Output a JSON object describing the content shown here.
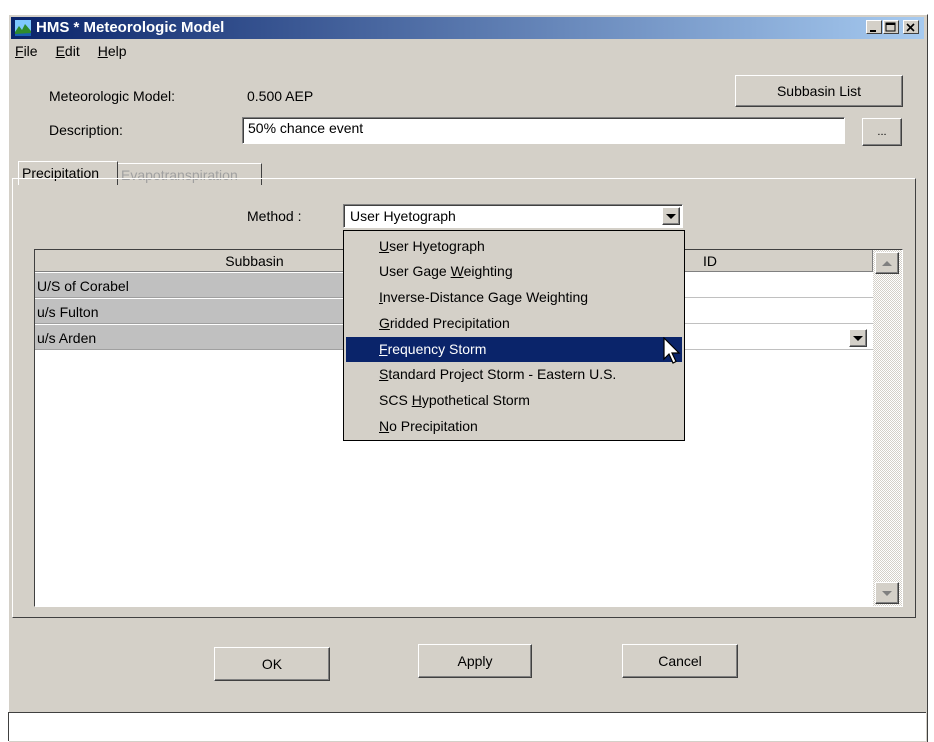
{
  "window": {
    "title": "HMS * Meteorologic Model",
    "controls": [
      "minimize",
      "maximize",
      "close"
    ]
  },
  "menu": [
    {
      "label": "File",
      "mnemonic": "F",
      "rest": "ile"
    },
    {
      "label": "Edit",
      "mnemonic": "E",
      "rest": "dit"
    },
    {
      "label": "Help",
      "mnemonic": "H",
      "rest": "elp"
    }
  ],
  "form": {
    "model_label": "Meteorologic Model:",
    "model_value": "0.500 AEP",
    "description_label": "Description:",
    "description_value": "50% chance event",
    "subbasin_list_button": "Subbasin List",
    "ellipsis_button": "..."
  },
  "tabs": [
    {
      "label": "Precipitation",
      "active": true
    },
    {
      "label": "Evapotranspiration",
      "active": false
    }
  ],
  "method": {
    "label": "Method :",
    "value": "User Hyetograph",
    "options": [
      {
        "pre": "",
        "u": "U",
        "post": "ser Hyetograph",
        "selected": false
      },
      {
        "pre": "User Gage ",
        "u": "W",
        "post": "eighting",
        "selected": false
      },
      {
        "pre": "",
        "u": "I",
        "post": "nverse-Distance Gage Weighting",
        "selected": false
      },
      {
        "pre": "",
        "u": "G",
        "post": "ridded Precipitation",
        "selected": false
      },
      {
        "pre": "",
        "u": "F",
        "post": "requency Storm",
        "selected": true
      },
      {
        "pre": "",
        "u": "S",
        "post": "tandard Project Storm - Eastern U.S.",
        "selected": false
      },
      {
        "pre": "SCS ",
        "u": "H",
        "post": "ypothetical Storm",
        "selected": false
      },
      {
        "pre": "",
        "u": "N",
        "post": "o Precipitation",
        "selected": false
      }
    ]
  },
  "table": {
    "headers": [
      "Subbasin",
      "ID"
    ],
    "rows": [
      "U/S of Corabel",
      "u/s Fulton",
      "u/s Arden"
    ]
  },
  "buttons": {
    "ok": "OK",
    "apply": "Apply",
    "cancel": "Cancel"
  },
  "colors": {
    "title_bar": "#0a246a",
    "selection": "#0a246a",
    "face": "#d4d0c8"
  }
}
